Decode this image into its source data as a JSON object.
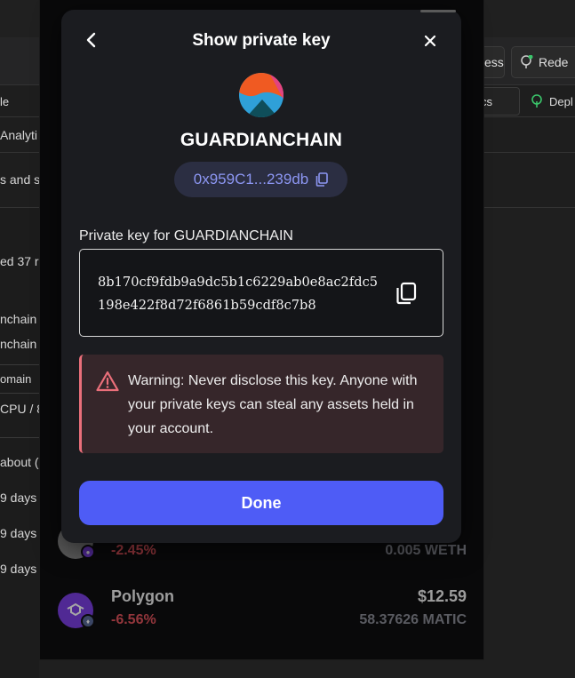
{
  "background_page": {
    "buttons": {
      "ess_label": "ess",
      "redeem_label": "Rede"
    },
    "tabs": {
      "left_label": "le",
      "metrics_label": "cs",
      "deploy_label": "Depl"
    },
    "row2_label": "Analyti",
    "row3_label": "s and s",
    "status_text": "ed 37 r",
    "list_items": [
      "nchain",
      "nchain"
    ],
    "domain_label": "omain",
    "cpu_label": "CPU / 8",
    "about_label": "about (",
    "days": [
      "9 days",
      "9 days",
      "9 days"
    ]
  },
  "wallet": {
    "assets": [
      {
        "name": "",
        "change": "-2.45%",
        "value": "",
        "amount": "0.005 WETH",
        "logo_color": "#8a8a8a",
        "badge_color": "#7b3fe4"
      },
      {
        "name": "Polygon",
        "change": "-6.56%",
        "value": "$12.59",
        "amount": "58.37626 MATIC",
        "logo_color": "#7b3fe4",
        "badge_color": "#5a6a9a"
      }
    ]
  },
  "modal": {
    "title": "Show private key",
    "account_name": "GUARDIANCHAIN",
    "address_short": "0x959C1...239db",
    "private_key_label": "Private key for GUARDIANCHAIN",
    "private_key": "8b170cf9fdb9a9dc5b1c6229ab0e8ac2fdc5198e422f8d72f6861b59cdf8c7b8",
    "warning_text": "Warning: Never disclose this key. Anyone with your private keys can steal any assets held in your account.",
    "done_label": "Done",
    "colors": {
      "accent": "#4e5cf6",
      "warning_border": "#ea6f7a",
      "warning_bg": "#36262a",
      "address_text": "#8c96f2"
    }
  }
}
